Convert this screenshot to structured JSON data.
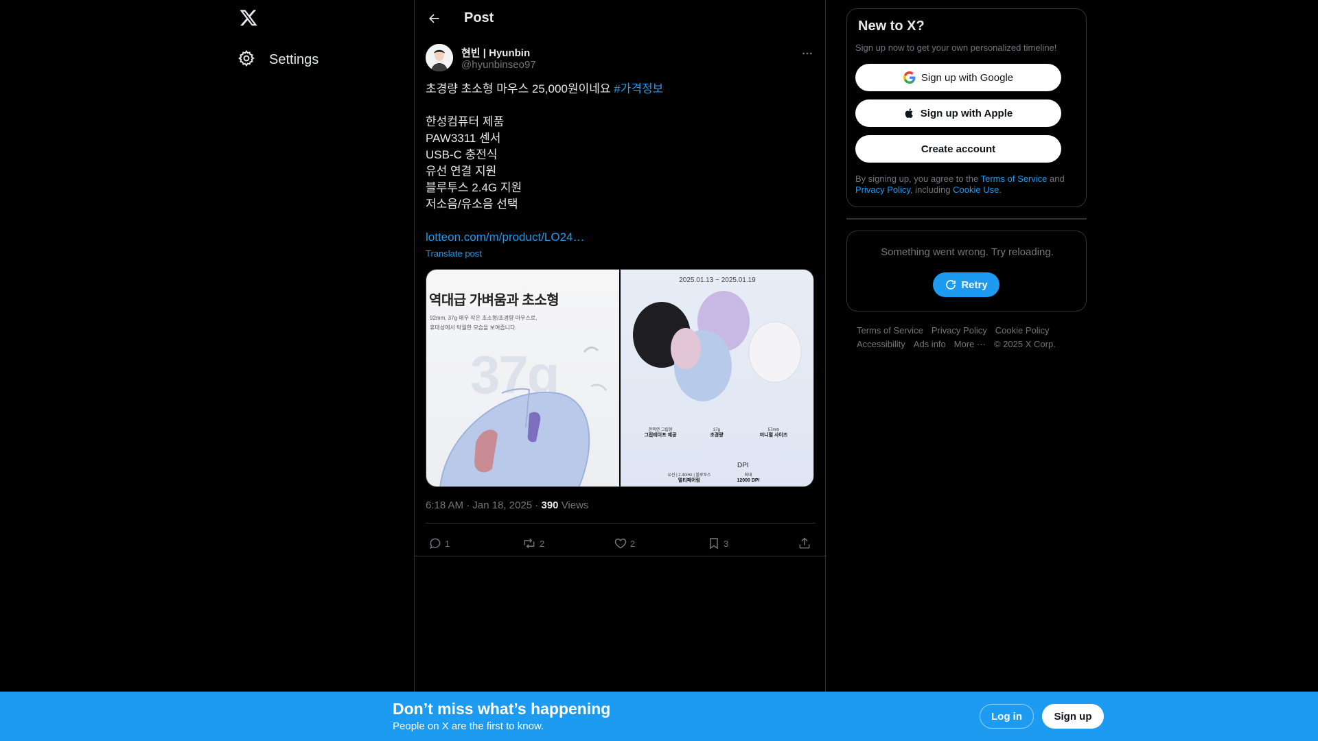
{
  "nav": {
    "settings_label": "Settings"
  },
  "header": {
    "title": "Post"
  },
  "post": {
    "author_name": "현빈 | Hyunbin",
    "author_handle": "@hyunbinseo97",
    "line1_text": "초경량 초소형 마우스 25,000원이네요 ",
    "line1_hashtag": "#가격정보",
    "lines": [
      "한성컴퓨터 제품",
      "PAW3311 센서",
      "USB-C 충전식",
      "유선 연결 지원",
      "블루투스 2.4G 지원",
      "저소음/유소음 선택"
    ],
    "link": "lotteon.com/m/product/LO24…",
    "translate_label": "Translate post",
    "media": {
      "left_title": "역대급 가벼움과 초소형",
      "left_sub1": "92mm, 37g 매우 작은 초소형/초경량 마우스로,",
      "left_sub2": "휴대성에서 탁월한 모습을 보여줍니다.",
      "left_big": "37g",
      "right_date": "2025.01.13 ~ 2025.01.19",
      "feat1_small": "한쪽면 그립형",
      "feat1_big": "그립테이프 제공",
      "feat2_small": "37g",
      "feat2_big": "초경량",
      "feat3_small": "57mm",
      "feat3_big": "미니멀 사이즈",
      "feat4_small": "유선 | 2.4GHz | 블루투스",
      "feat4_big": "멀티페어링",
      "feat5_title": "DPI",
      "feat5_small": "최대",
      "feat5_big": "12000 DPI"
    },
    "time": "6:18 AM",
    "date": "Jan 18, 2025",
    "views_count": "390",
    "views_label": "Views",
    "counts": {
      "reply": "1",
      "repost": "2",
      "like": "2",
      "bookmark": "3"
    }
  },
  "signup": {
    "title": "New to X?",
    "subtitle": "Sign up now to get your own personalized timeline!",
    "google_label": "Sign up with Google",
    "apple_label": "Sign up with Apple",
    "create_label": "Create account",
    "legal_prefix": "By signing up, you agree to the ",
    "legal_tos": "Terms of Service",
    "legal_and": " and ",
    "legal_privacy": "Privacy Policy",
    "legal_including": ", including ",
    "legal_cookie": "Cookie Use",
    "legal_end": "."
  },
  "error": {
    "message": "Something went wrong. Try reloading.",
    "retry_label": "Retry"
  },
  "footer": {
    "terms": "Terms of Service",
    "privacy": "Privacy Policy",
    "cookie": "Cookie Policy",
    "accessibility": "Accessibility",
    "ads": "Ads info",
    "more": "More ···",
    "copyright": "© 2025 X Corp."
  },
  "bottom_bar": {
    "title": "Don’t miss what’s happening",
    "subtitle": "People on X are the first to know.",
    "login_label": "Log in",
    "signup_label": "Sign up"
  },
  "colors": {
    "accent": "#1d9bf0",
    "background": "#000000",
    "border": "#2f3336",
    "muted": "#71767b"
  }
}
